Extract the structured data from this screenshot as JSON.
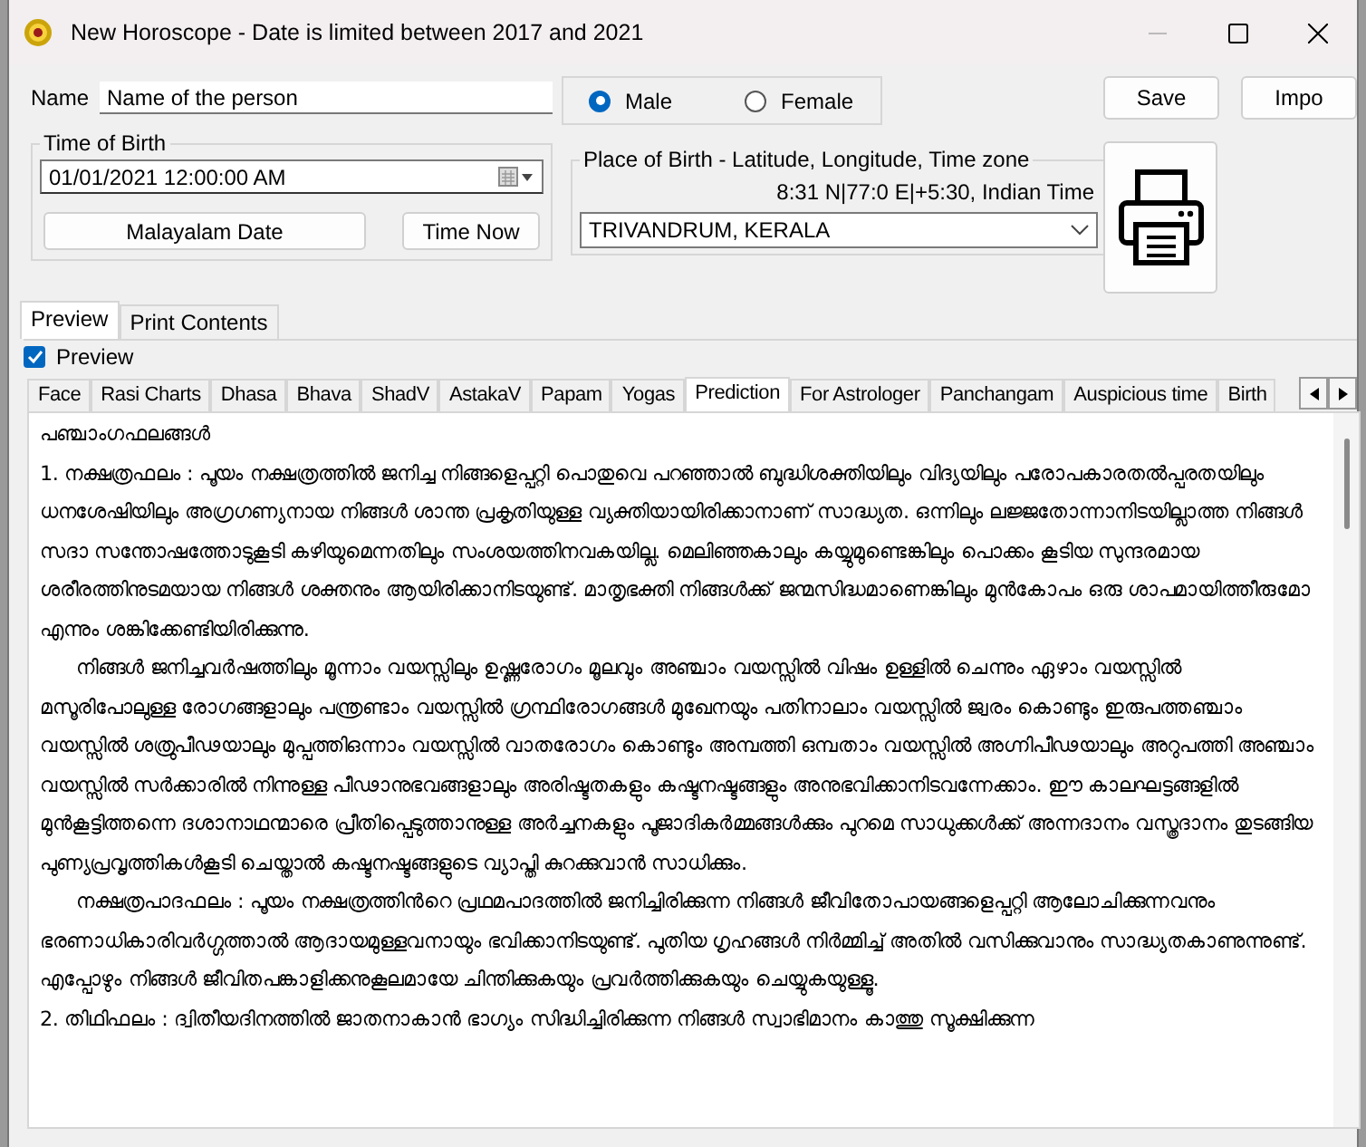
{
  "window": {
    "title": "New Horoscope - Date is limited between 2017 and 2021"
  },
  "name": {
    "label": "Name",
    "value": "Name of the person"
  },
  "gender": [
    {
      "label": "Male",
      "selected": true
    },
    {
      "label": "Female",
      "selected": false
    }
  ],
  "buttons": [
    "Save",
    "Impo"
  ],
  "time_of_birth": {
    "legend": "Time of Birth",
    "value": "01/01/2021  12:00:00 AM",
    "buttons": [
      "Malayalam Date",
      "Time Now"
    ]
  },
  "place_of_birth": {
    "legend": "Place of Birth - Latitude, Longitude, Time zone",
    "coordinates": "8:31 N|77:0 E|+5:30, Indian Time",
    "value": "TRIVANDRUM, KERALA"
  },
  "outer_tabs": [
    {
      "label": "Preview",
      "selected": true
    },
    {
      "label": "Print Contents",
      "selected": false
    }
  ],
  "preview_checkbox": {
    "label": "Preview",
    "checked": true
  },
  "tabs": [
    {
      "label": "Face",
      "selected": false
    },
    {
      "label": "Rasi Charts",
      "selected": false
    },
    {
      "label": "Dhasa",
      "selected": false
    },
    {
      "label": "Bhava",
      "selected": false
    },
    {
      "label": "ShadV",
      "selected": false
    },
    {
      "label": "AstakaV",
      "selected": false
    },
    {
      "label": "Papam",
      "selected": false
    },
    {
      "label": "Yogas",
      "selected": false
    },
    {
      "label": "Prediction",
      "selected": true
    },
    {
      "label": "For Astrologer",
      "selected": false
    },
    {
      "label": "Panchangam",
      "selected": false
    },
    {
      "label": "Auspicious time",
      "selected": false
    },
    {
      "label": "Birth",
      "selected": false
    }
  ],
  "content": [
    {
      "kind": "heading",
      "text": "പഞ്ചാംഗഫലങ്ങൾ"
    },
    {
      "kind": "paragraph",
      "text": "1. നക്ഷത്രഫലം : പൂയം നക്ഷത്രത്തിൽ ജനിച്ച നിങ്ങളെപ്പറ്റി പൊതുവെ പറഞ്ഞാൽ ബുദ്ധിശക്തിയിലും വിദ്യയിലും പരോപകാരതൽപ്പരതയിലും ധനശേഷിയിലും അഗ്രഗണ്യനായ നിങ്ങൾ ശാന്ത പ്രകൃതിയുള്ള വ്യക്തിയായിരിക്കാനാണ് സാദ്ധ്യത. ഒന്നിലും ലജ്ജതോന്നാനിടയില്ലാത്ത നിങ്ങൾ സദാ സന്തോഷത്തോടുകൂടി കഴിയുമെന്നതിലും സംശയത്തിനവകയില്ല. മെലിഞ്ഞകാലും കയ്യുമുണ്ടെങ്കിലും പൊക്കം കൂടിയ സുന്ദരമായ ശരീരത്തിനുടമയായ നിങ്ങൾ ശക്തനും ആയിരിക്കാനിടയുണ്ട്. മാതൃഭക്തി നിങ്ങൾക്ക് ജന്മസിദ്ധമാണെങ്കിലും മുൻകോപം ഒരു ശാപമായിത്തീരുമോ എന്നും ശങ്കിക്കേണ്ടിയിരിക്കുന്നു."
    },
    {
      "kind": "indented",
      "text": "നിങ്ങൾ ജനിച്ചവർഷത്തിലും മൂന്നാം വയസ്സിലും ഉഷ്ണരോഗം മൂലവും അഞ്ചാം വയസ്സിൽ വിഷം ഉള്ളിൽ ചെന്നും ഏഴാം വയസ്സിൽ മസൂരിപോലുള്ള രോഗങ്ങളാലും പന്ത്രണ്ടാം വയസ്സിൽ ഗ്രന്ഥിരോഗങ്ങൾ മുഖേനയും പതിനാലാം വയസ്സിൽ ജ്വരം കൊണ്ടും ഇരുപത്തഞ്ചാം വയസ്സിൽ ശത്രുപീഢയാലും മുപ്പത്തിഒന്നാം വയസ്സിൽ വാതരോഗം കൊണ്ടും അമ്പത്തി ഒമ്പതാം വയസ്സിൽ അഗ്നിപീഢയാലും അറുപത്തി അഞ്ചാം വയസ്സിൽ സർക്കാരിൽ നിന്നുള്ള പീഢാനുഭവങ്ങളാലും അരിഷ്ടതകളും കഷ്ടനഷ്ടങ്ങളും അനുഭവിക്കാനിടവന്നേക്കാം. ഈ കാലഘട്ടങ്ങളിൽ മുൻകൂട്ടിത്തന്നെ ദശാനാഥന്മാരെ പ്രീതിപ്പെടുത്താനുള്ള അർച്ചനകളും പൂജാദികർമ്മങ്ങൾക്കും പുറമെ സാധുക്കൾക്ക് അന്നദാനം വസ്ത്രദാനം തുടങ്ങിയ പുണ്യപ്രവൃത്തികൾകൂടി ചെയ്താൽ കഷ്ടനഷ്ടങ്ങളുടെ വ്യാപ്തി കുറക്കുവാൻ സാധിക്കും."
    },
    {
      "kind": "indented",
      "text": "നക്ഷത്രപാദഫലം : പൂയം നക്ഷത്രത്തിൻറെ പ്രഥമപാദത്തിൽ ജനിച്ചിരിക്കുന്ന നിങ്ങൾ ജീവിതോപായങ്ങളെപ്പറ്റി ആലോചിക്കുന്നവനും ഭരണാധികാരിവർഗ്ഗത്താൽ ആദായമുള്ളവനായും ഭവിക്കാനിടയുണ്ട്. പുതിയ ഗൃഹങ്ങൾ നിർമ്മിച്ച് അതിൽ വസിക്കുവാനും സാദ്ധ്യതകാണുന്നുണ്ട്. എപ്പോഴും നിങ്ങൾ ജീവിതപങ്കാളിക്കനുകൂലമായേ ചിന്തിക്കുകയും പ്രവർത്തിക്കുകയും ചെയ്യുകയുള്ളൂ."
    },
    {
      "kind": "paragraph",
      "text": "2. തിഥിഫലം : ദ്വിതീയദിനത്തിൽ ജാതനാകാൻ ഭാഗ്യം സിദ്ധിച്ചിരിക്കുന്ന നിങ്ങൾ സ്വാഭിമാനം കാത്തു സൂക്ഷിക്കുന്ന"
    }
  ]
}
